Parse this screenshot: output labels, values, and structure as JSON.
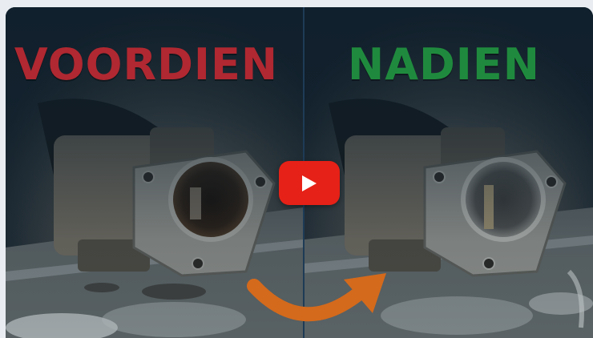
{
  "video": {
    "before_label": "VOORDIEN",
    "after_label": "NADIEN",
    "play_icon": "play-icon",
    "arrow_icon": "curved-arrow-icon"
  },
  "colors": {
    "before": "#b02831",
    "after": "#1f8a3d",
    "play_button": "#e62117",
    "arrow": "#d46a1c",
    "background": "#0f1f2b"
  }
}
